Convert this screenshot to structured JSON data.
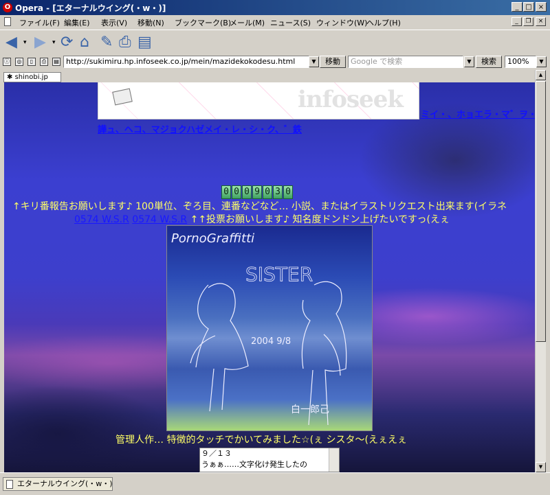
{
  "window": {
    "title": "Opera - [エターナルウイング(・w・)]"
  },
  "menu": [
    "ファイル(F)",
    "編集(E)",
    "表示(V)",
    "移動(N)",
    "ブックマーク(B)",
    "メール(M)",
    "ニュース(S)",
    "ウィンドウ(W)",
    "ヘルプ(H)"
  ],
  "address": {
    "url": "http://sukimiru.hp.infoseek.co.jp/mein/mazidekokodesu.html",
    "go_label": "移動"
  },
  "search": {
    "placeholder": "Google で検索",
    "button_label": "検索"
  },
  "zoom": "100%",
  "tab": {
    "label": "shinobi.jp"
  },
  "banner": {
    "logo": "infoseek",
    "side_text": "ミイ・、ホョエラ・マ゛ヲ・ラ",
    "garbled_link": "譁ュ、ヘコ、マジョクハゼメイ・レ・シ・ク、゛鉄"
  },
  "counter": "0009030",
  "page": {
    "line1": "↑キリ番報告お願いします♪ 100単位、ぞろ目、連番などなど… 小説、またはイラストリクエスト出来ます(イラネ",
    "vote_link_1": "0574 W.S.R",
    "vote_link_2": "0574 W.S.R",
    "line2": "↑↑投票お願いします♪ 知名度ドンドン上げたいですっ(えぇ",
    "caption": "管理人作… 特徴的タッチでかいてみました☆(ぇ シスタ～(えぇえぇ",
    "news_line1": "９／１３",
    "news_line2": "うぁぁ……文字化け発生したの"
  },
  "artwork": {
    "title_text": "PornoGraffitti",
    "word_text": "SISTER",
    "date_text": "2004 9/8",
    "signature_text": "白一郎己"
  },
  "status": {
    "tab_label": "エターナルウイング(・w・)"
  }
}
